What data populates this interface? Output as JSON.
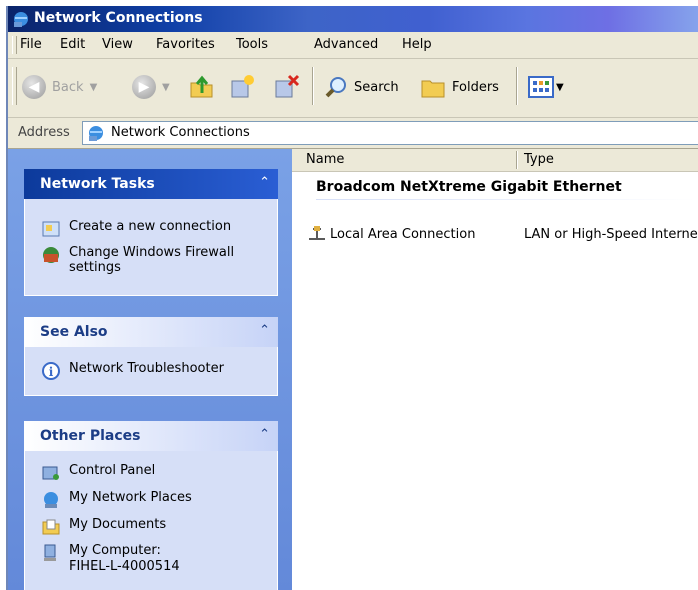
{
  "window": {
    "title": "Network Connections"
  },
  "menu": [
    "File",
    "Edit",
    "View",
    "Favorites",
    "Tools",
    "Advanced",
    "Help"
  ],
  "toolbar": {
    "back": "Back",
    "search": "Search",
    "folders": "Folders"
  },
  "address": {
    "label": "Address",
    "value": "Network Connections"
  },
  "network_tasks": {
    "title": "Network Tasks",
    "items": [
      "Create a new connection",
      "Change Windows Firewall settings"
    ]
  },
  "see_also": {
    "title": "See Also",
    "items": [
      "Network Troubleshooter"
    ]
  },
  "other_places": {
    "title": "Other Places",
    "items": [
      "Control Panel",
      "My Network Places",
      "My Documents",
      "My Computer:",
      "FIHEL-L-4000514"
    ]
  },
  "list": {
    "columns": {
      "name": "Name",
      "type": "Type"
    },
    "group": "Broadcom NetXtreme Gigabit Ethernet",
    "rows": [
      {
        "name": "Local Area Connection",
        "type": "LAN or High-Speed Internet"
      }
    ]
  }
}
